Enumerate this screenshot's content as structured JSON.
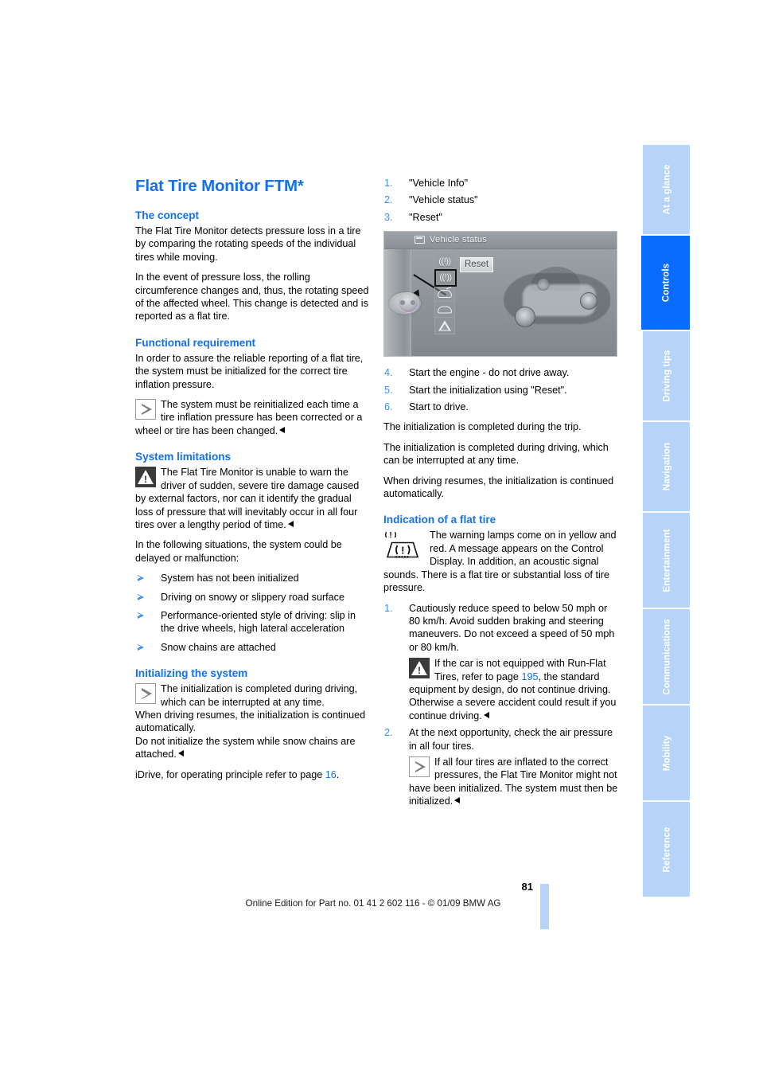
{
  "document": {
    "page_number": "81",
    "footer": "Online Edition for Part no. 01 41 2 602 116 - © 01/09 BMW AG"
  },
  "side_tabs": [
    {
      "label": "At a glance",
      "active": false
    },
    {
      "label": "Controls",
      "active": true
    },
    {
      "label": "Driving tips",
      "active": false
    },
    {
      "label": "Navigation",
      "active": false
    },
    {
      "label": "Entertainment",
      "active": false
    },
    {
      "label": "Communications",
      "active": false
    },
    {
      "label": "Mobility",
      "active": false
    },
    {
      "label": "Reference",
      "active": false
    }
  ],
  "colors": {
    "heading_blue": "#1470ee",
    "accent_blue": "#3c8ef0",
    "tab_active": "#0a6cff",
    "tab_inactive": "#b6d4f8"
  },
  "left_column": {
    "chapter_title": "Flat Tire Monitor FTM*",
    "concept": {
      "heading": "The concept",
      "para_1": "The Flat Tire Monitor detects pressure loss in a tire by comparing the rotating speeds of the individual tires while moving.",
      "para_2": "In the event of pressure loss, the rolling circumference changes and, thus, the rotating speed of the affected wheel. This change is detected and is reported as a flat tire."
    },
    "functional_requirement": {
      "heading": "Functional requirement",
      "para_1": "In order to assure the reliable reporting of a flat tire, the system must be initialized for the correct tire inflation pressure.",
      "note": "The system must be reinitialized each time a tire inflation pressure has been corrected or a wheel or tire has been changed."
    },
    "system_limitations": {
      "heading": "System limitations",
      "warning": "The Flat Tire Monitor is unable to warn the driver of sudden, severe tire damage caused by external factors, nor can it identify the gradual loss of pressure that will inevitably occur in all four tires over a lengthy period of time.",
      "intro": "In the following situations, the system could be delayed or malfunction:",
      "bullets": [
        "System has not been initialized",
        "Driving on snowy or slippery road surface",
        "Performance-oriented style of driving: slip in the drive wheels, high lateral acceleration",
        "Snow chains are attached"
      ]
    },
    "initializing": {
      "heading": "Initializing the system",
      "note_line_1": "The initialization is completed during driving, which can be interrupted at any time.",
      "note_line_2": "When driving resumes, the initialization is continued automatically.",
      "note_line_3": "Do not initialize the system while snow chains are attached.",
      "idrive_text_before": "iDrive, for operating principle refer to page ",
      "idrive_page_ref": "16",
      "idrive_text_after": "."
    }
  },
  "right_column": {
    "steps_top": [
      {
        "num": "1.",
        "text": "\"Vehicle Info\""
      },
      {
        "num": "2.",
        "text": "\"Vehicle status\""
      },
      {
        "num": "3.",
        "text": "\"Reset\""
      }
    ],
    "idrive_screenshot": {
      "header_title": "Vehicle status",
      "tooltip_label": "Reset",
      "icons": [
        "tire-pressure-icon-1",
        "tire-pressure-icon-2-selected",
        "oil-level-icon",
        "vehicle-icon",
        "warning-icon"
      ],
      "selected_icon_index": 1
    },
    "steps_bottom": [
      {
        "num": "4.",
        "text": "Start the engine - do not drive away."
      },
      {
        "num": "5.",
        "text": "Start the initialization using \"Reset\"."
      },
      {
        "num": "6.",
        "text": "Start to drive."
      }
    ],
    "para_after_steps_1": "The initialization is completed during the trip.",
    "para_after_steps_2": "The initialization is completed during driving, which can be interrupted at any time.",
    "para_after_steps_3": "When driving resumes, the initialization is continued automatically.",
    "indication": {
      "heading": "Indication of a flat tire",
      "warning_lamp_text": "The warning lamps come on in yellow and red. A message appears on the Control Display. In addition, an acoustic signal sounds. There is a flat tire or substantial loss of tire pressure.",
      "step_1": {
        "num": "1.",
        "text": "Cautiously reduce speed to below 50 mph or 80 km/h. Avoid sudden braking and steering maneuvers. Do not exceed a speed of 50 mph or 80 km/h.",
        "warning_before": "If the car is not equipped with Run-Flat Tires, refer to page ",
        "warning_page_ref": "195",
        "warning_after": ", the standard equipment by design, do not continue driving. Otherwise a severe accident could result if you continue driving."
      },
      "step_2": {
        "num": "2.",
        "text": "At the next opportunity, check the air pressure in all four tires.",
        "note": "If all four tires are inflated to the correct pressures, the Flat Tire Monitor might not have been initialized. The system must then be initialized."
      }
    }
  }
}
